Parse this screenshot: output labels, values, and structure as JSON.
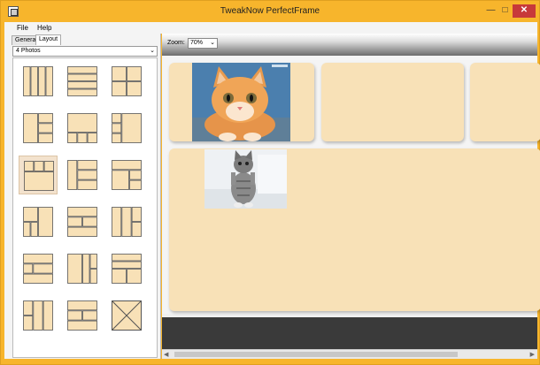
{
  "window": {
    "title": "TweakNow PerfectFrame",
    "minimize_glyph": "—",
    "maximize_glyph": "□",
    "close_glyph": "✕"
  },
  "menu": {
    "file": "File",
    "help": "Help"
  },
  "left_panel": {
    "tabs": {
      "general": "General",
      "layout": "Layout"
    },
    "preset": "4 Photos",
    "selected_layout": 6
  },
  "toolbar": {
    "zoom_label": "Zoom:",
    "zoom_value": "70%"
  },
  "colors": {
    "accent": "#f7b52c",
    "cell_fill": "#f8e1b7",
    "close": "#c7393a"
  }
}
